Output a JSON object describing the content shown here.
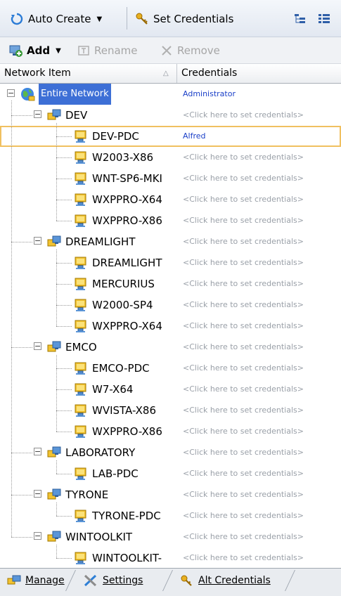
{
  "toolbar": {
    "auto_create": "Auto Create",
    "set_credentials": "Set Credentials",
    "add": "Add",
    "rename": "Rename",
    "remove": "Remove"
  },
  "columns": {
    "network_item": "Network Item",
    "credentials": "Credentials"
  },
  "tree": {
    "root": {
      "label": "Entire Network",
      "credentials": "Administrator"
    },
    "groups": [
      {
        "label": "DEV",
        "credentials": "<Click here to set credentials>",
        "children": [
          {
            "label": "DEV-PDC",
            "credentials": "Alfred"
          },
          {
            "label": "W2003-X86",
            "credentials": "<Click here to set credentials>"
          },
          {
            "label": "WNT-SP6-MKI",
            "credentials": "<Click here to set credentials>"
          },
          {
            "label": "WXPPRO-X64",
            "credentials": "<Click here to set credentials>"
          },
          {
            "label": "WXPPRO-X86",
            "credentials": "<Click here to set credentials>"
          }
        ]
      },
      {
        "label": "DREAMLIGHT",
        "credentials": "<Click here to set credentials>",
        "children": [
          {
            "label": "DREAMLIGHT",
            "credentials": "<Click here to set credentials>"
          },
          {
            "label": "MERCURIUS",
            "credentials": "<Click here to set credentials>"
          },
          {
            "label": "W2000-SP4",
            "credentials": "<Click here to set credentials>"
          },
          {
            "label": "WXPPRO-X64",
            "credentials": "<Click here to set credentials>"
          }
        ]
      },
      {
        "label": "EMCO",
        "credentials": "<Click here to set credentials>",
        "children": [
          {
            "label": "EMCO-PDC",
            "credentials": "<Click here to set credentials>"
          },
          {
            "label": "W7-X64",
            "credentials": "<Click here to set credentials>"
          },
          {
            "label": "WVISTA-X86",
            "credentials": "<Click here to set credentials>"
          },
          {
            "label": "WXPPRO-X86",
            "credentials": "<Click here to set credentials>"
          }
        ]
      },
      {
        "label": "LABORATORY",
        "credentials": "<Click here to set credentials>",
        "children": [
          {
            "label": "LAB-PDC",
            "credentials": "<Click here to set credentials>"
          }
        ]
      },
      {
        "label": "TYRONE",
        "credentials": "<Click here to set credentials>",
        "children": [
          {
            "label": "TYRONE-PDC",
            "credentials": "<Click here to set credentials>"
          }
        ]
      },
      {
        "label": "WINTOOLKIT",
        "credentials": "<Click here to set credentials>",
        "children": [
          {
            "label": "WINTOOLKIT-",
            "credentials": "<Click here to set credentials>"
          }
        ]
      }
    ]
  },
  "tabs": {
    "manage": "Manage",
    "settings": "Settings",
    "alt_credentials": "Alt Credentials"
  },
  "colors": {
    "selection": "#3d6fd6",
    "credentials_set": "#1a3fc8",
    "credentials_placeholder": "#9aa0a8",
    "focus_outline": "#f0c060"
  }
}
